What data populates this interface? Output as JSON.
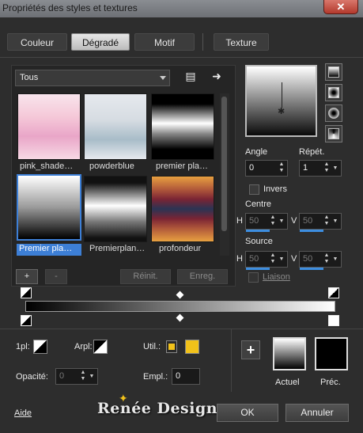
{
  "window": {
    "title": "Propriétés des styles et textures",
    "close": "✕"
  },
  "tabs": [
    {
      "label": "Couleur",
      "active": false
    },
    {
      "label": "Dégradé",
      "active": true
    },
    {
      "label": "Motif",
      "active": false
    },
    {
      "label": "Texture",
      "active": false
    }
  ],
  "library": {
    "category": "Tous",
    "swatches": [
      {
        "label": "pink_shade…",
        "colors": [
          "#f5c8d8",
          "#e9a6c8",
          "#f8e4ec"
        ]
      },
      {
        "label": "powderblue",
        "colors": [
          "#e2e4ea",
          "#a8bcc8",
          "#e6e9ee"
        ]
      },
      {
        "label": "premier pla…",
        "colors": [
          "#000000",
          "#ffffff",
          "#000000"
        ]
      },
      {
        "label": "Premier pla…",
        "colors": [
          "#ffffff",
          "#000000"
        ],
        "selected": true
      },
      {
        "label": "Premierplan…",
        "colors": [
          "#111111",
          "#ffffff",
          "#111111"
        ]
      },
      {
        "label": "profondeur",
        "colors": [
          "#e8a040",
          "#7a2434",
          "#2a3454",
          "#7a2434",
          "#e8a040"
        ]
      }
    ],
    "add": "+",
    "remove": "-",
    "reset": "Réinit.",
    "save": "Enreg."
  },
  "settings": {
    "angle_label": "Angle",
    "angle_value": "0",
    "repeat_label": "Répét.",
    "repeat_value": "1",
    "invert_label": "Invers",
    "center_label": "Centre",
    "center_h_label": "H",
    "center_h": "50",
    "center_v_label": "V",
    "center_v": "50",
    "source_label": "Source",
    "source_h_label": "H",
    "source_h": "50",
    "source_v_label": "V",
    "source_v": "50",
    "link_label": "Liaison"
  },
  "stops": {
    "fg_label": "1pl:",
    "bg_label": "Arpl:",
    "user_label": "Util.:",
    "user_color": "#f2c21a",
    "opacity_label": "Opacité:",
    "opacity_value": "0",
    "location_label": "Empl.:",
    "location_value": "0",
    "add_stop": "+",
    "current_label": "Actuel",
    "previous_label": "Préc."
  },
  "footer": {
    "help": "Aide",
    "ok": "OK",
    "cancel": "Annuler",
    "watermark": "Renée Design"
  }
}
